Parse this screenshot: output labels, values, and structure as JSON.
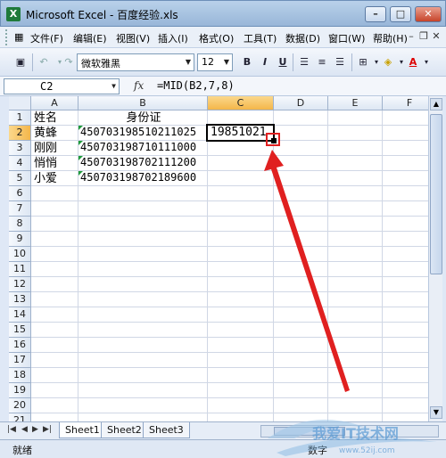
{
  "window": {
    "title": "Microsoft Excel - 百度经验.xls"
  },
  "menu": [
    "文件(F)",
    "编辑(E)",
    "视图(V)",
    "插入(I)",
    "格式(O)",
    "工具(T)",
    "数据(D)",
    "窗口(W)",
    "帮助(H)"
  ],
  "toolbar": {
    "font": "微软雅黑",
    "size": "12",
    "bold": "B",
    "italic": "I",
    "underline": "U"
  },
  "formula_bar": {
    "cell_ref": "C2",
    "fx": "fx",
    "formula": "=MID(B2,7,8)"
  },
  "columns": [
    "A",
    "B",
    "C",
    "D",
    "E",
    "F"
  ],
  "rows": [
    "1",
    "2",
    "3",
    "4",
    "5",
    "6",
    "7",
    "8",
    "9",
    "10",
    "11",
    "12",
    "13",
    "14",
    "15",
    "16",
    "17",
    "18",
    "19",
    "20",
    "21"
  ],
  "cells": {
    "A1": "姓名",
    "B1": "身份证",
    "A2": "黄蜂",
    "B2": "450703198510211025",
    "C2": "19851021",
    "A3": "刚刚",
    "B3": "450703198710111000",
    "A4": "悄悄",
    "B4": "450703198702111200",
    "A5": "小爱",
    "B5": "450703198702189600"
  },
  "sheets": [
    "Sheet1",
    "Sheet2",
    "Sheet3"
  ],
  "status": {
    "left": "就绪",
    "mode": "数字"
  },
  "watermark": "我爱IT技术网 www.52ij.com",
  "colors": {
    "accent": "#f4b64a",
    "arrow": "#e02020"
  }
}
